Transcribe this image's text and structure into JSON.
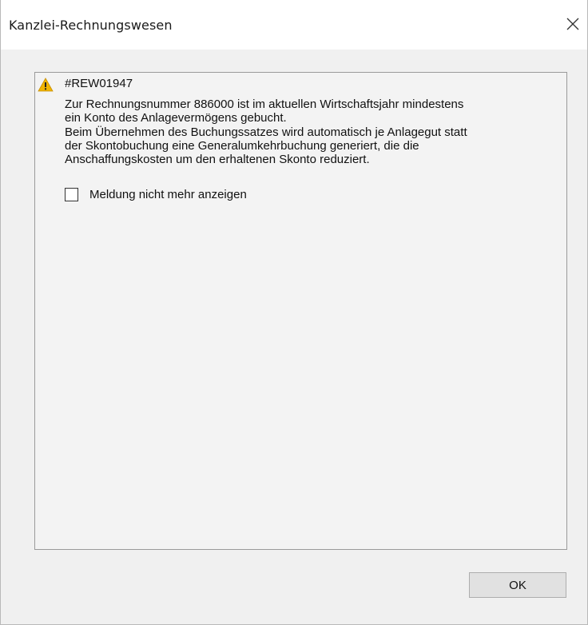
{
  "window": {
    "title": "Kanzlei-Rechnungswesen"
  },
  "message": {
    "code": "#REW01947",
    "lines": [
      "Zur Rechnungsnummer 886000 ist im aktuellen Wirtschaftsjahr mindestens",
      "ein Konto des Anlagevermögens gebucht.",
      "Beim Übernehmen des Buchungssatzes wird automatisch je Anlagegut statt",
      "der Skontobuchung eine Generalumkehrbuchung generiert, die die",
      "Anschaffungskosten um den erhaltenen Skonto reduziert."
    ],
    "icon": "warning-icon"
  },
  "checkbox": {
    "label": "Meldung nicht mehr anzeigen",
    "checked": false
  },
  "buttons": {
    "ok_label": "OK"
  },
  "colors": {
    "warning_fill": "#f0b400",
    "window_bg": "#f0f0f0",
    "titlebar_bg": "#ffffff"
  }
}
